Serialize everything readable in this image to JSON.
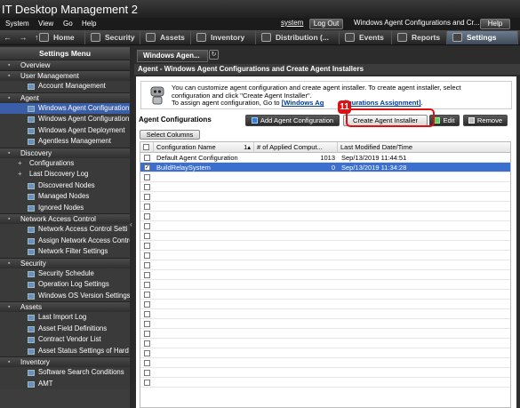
{
  "app": {
    "title": "IT Desktop Management 2",
    "menus": [
      "System",
      "View",
      "Go",
      "Help"
    ],
    "user": "system",
    "logout_label": "Log Out",
    "window_title": "Windows Agent Configurations and Cr...",
    "help_label": "Help"
  },
  "nav": {
    "arrows": "← → ↑",
    "tabs": [
      "Home",
      "Security",
      "Assets",
      "Inventory",
      "Distribution (...",
      "Events",
      "Reports",
      "Settings"
    ],
    "active": "Settings"
  },
  "sidebar": {
    "title": "Settings Menu",
    "sections": [
      {
        "label": "Overview",
        "items": []
      },
      {
        "label": "User Management",
        "items": [
          "Account Management"
        ]
      },
      {
        "label": "Agent",
        "items": [
          "Windows Agent Configuration",
          "Windows Agent Configuration",
          "Windows Agent Deployment",
          "Agentless Management"
        ]
      },
      {
        "label": "Discovery",
        "items": [
          "Configurations",
          "Last Discovery Log",
          "Discovered Nodes",
          "Managed Nodes",
          "Ignored Nodes"
        ]
      },
      {
        "label": "Network Access Control",
        "items": [
          "Network Access Control Setti",
          "Assign Network Access Contro",
          "Network Filter Settings"
        ]
      },
      {
        "label": "Security",
        "items": [
          "Security Schedule",
          "Operation Log Settings",
          "Windows OS Version Settings"
        ]
      },
      {
        "label": "Assets",
        "items": [
          "Last Import Log",
          "Asset Field Definitions",
          "Contract Vendor List",
          "Asset Status Settings of Hard"
        ]
      },
      {
        "label": "Inventory",
        "items": [
          "Software Search Conditions",
          "AMT"
        ]
      }
    ],
    "selected_item": "Windows Agent Configuration"
  },
  "content": {
    "tab_label": "Windows Agen...",
    "panel_title": "Agent - Windows Agent Configurations and Create Agent Installers",
    "info_line1": "You can customize agent configuration and create agent installer. To create agent installer, select",
    "info_line2": "configuration and click \"Create Agent Installer\".",
    "info_line3_prefix": "To assign agent configuration, Go to ",
    "info_link": "[Windows Agent Configurations Assignment]",
    "info_link_visible_a": "[Windows Ag",
    "info_link_visible_b": "figurations Assignment]",
    "info_link_suffix": ".",
    "section_title": "Agent Configurations",
    "buttons": {
      "add": "Add Agent Configuration",
      "create": "Create Agent Installer",
      "edit": "Edit",
      "remove": "Remove"
    },
    "step_badge": "11",
    "select_columns": "Select Columns",
    "columns": [
      "Configuration Name",
      "1",
      "# of Applied Comput...",
      "Last Modified Date/Time"
    ],
    "rows": [
      {
        "name": "Default Agent Configuration",
        "applied": "1013",
        "modified": "Sep/13/2019 11:44:51",
        "checked": false,
        "selected": false
      },
      {
        "name": "BuildRelaySystem",
        "applied": "0",
        "modified": "Sep/13/2019 11:34:28",
        "checked": true,
        "selected": true
      }
    ],
    "empty_rows": 22
  }
}
